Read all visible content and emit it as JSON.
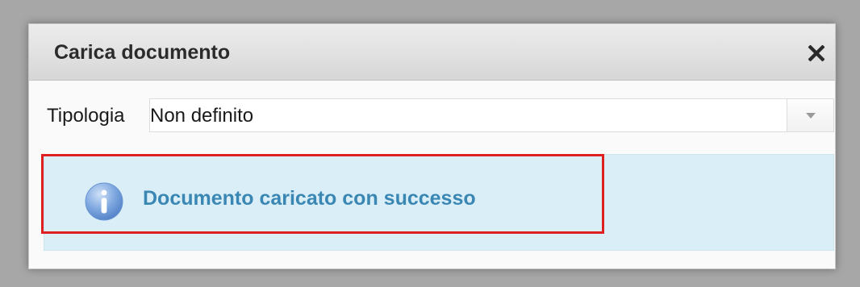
{
  "dialog": {
    "title": "Carica documento",
    "close_icon": "close-icon"
  },
  "form": {
    "tipologia_label": "Tipologia",
    "tipologia_value": "Non definito",
    "dropdown_icon": "chevron-down-icon"
  },
  "alert": {
    "message": "Documento caricato con successo",
    "icon": "info-icon"
  },
  "colors": {
    "backdrop": "#a7a7a7",
    "alert_background": "#daeef7",
    "alert_text": "#3a87b4",
    "highlight_border": "#e02020"
  }
}
